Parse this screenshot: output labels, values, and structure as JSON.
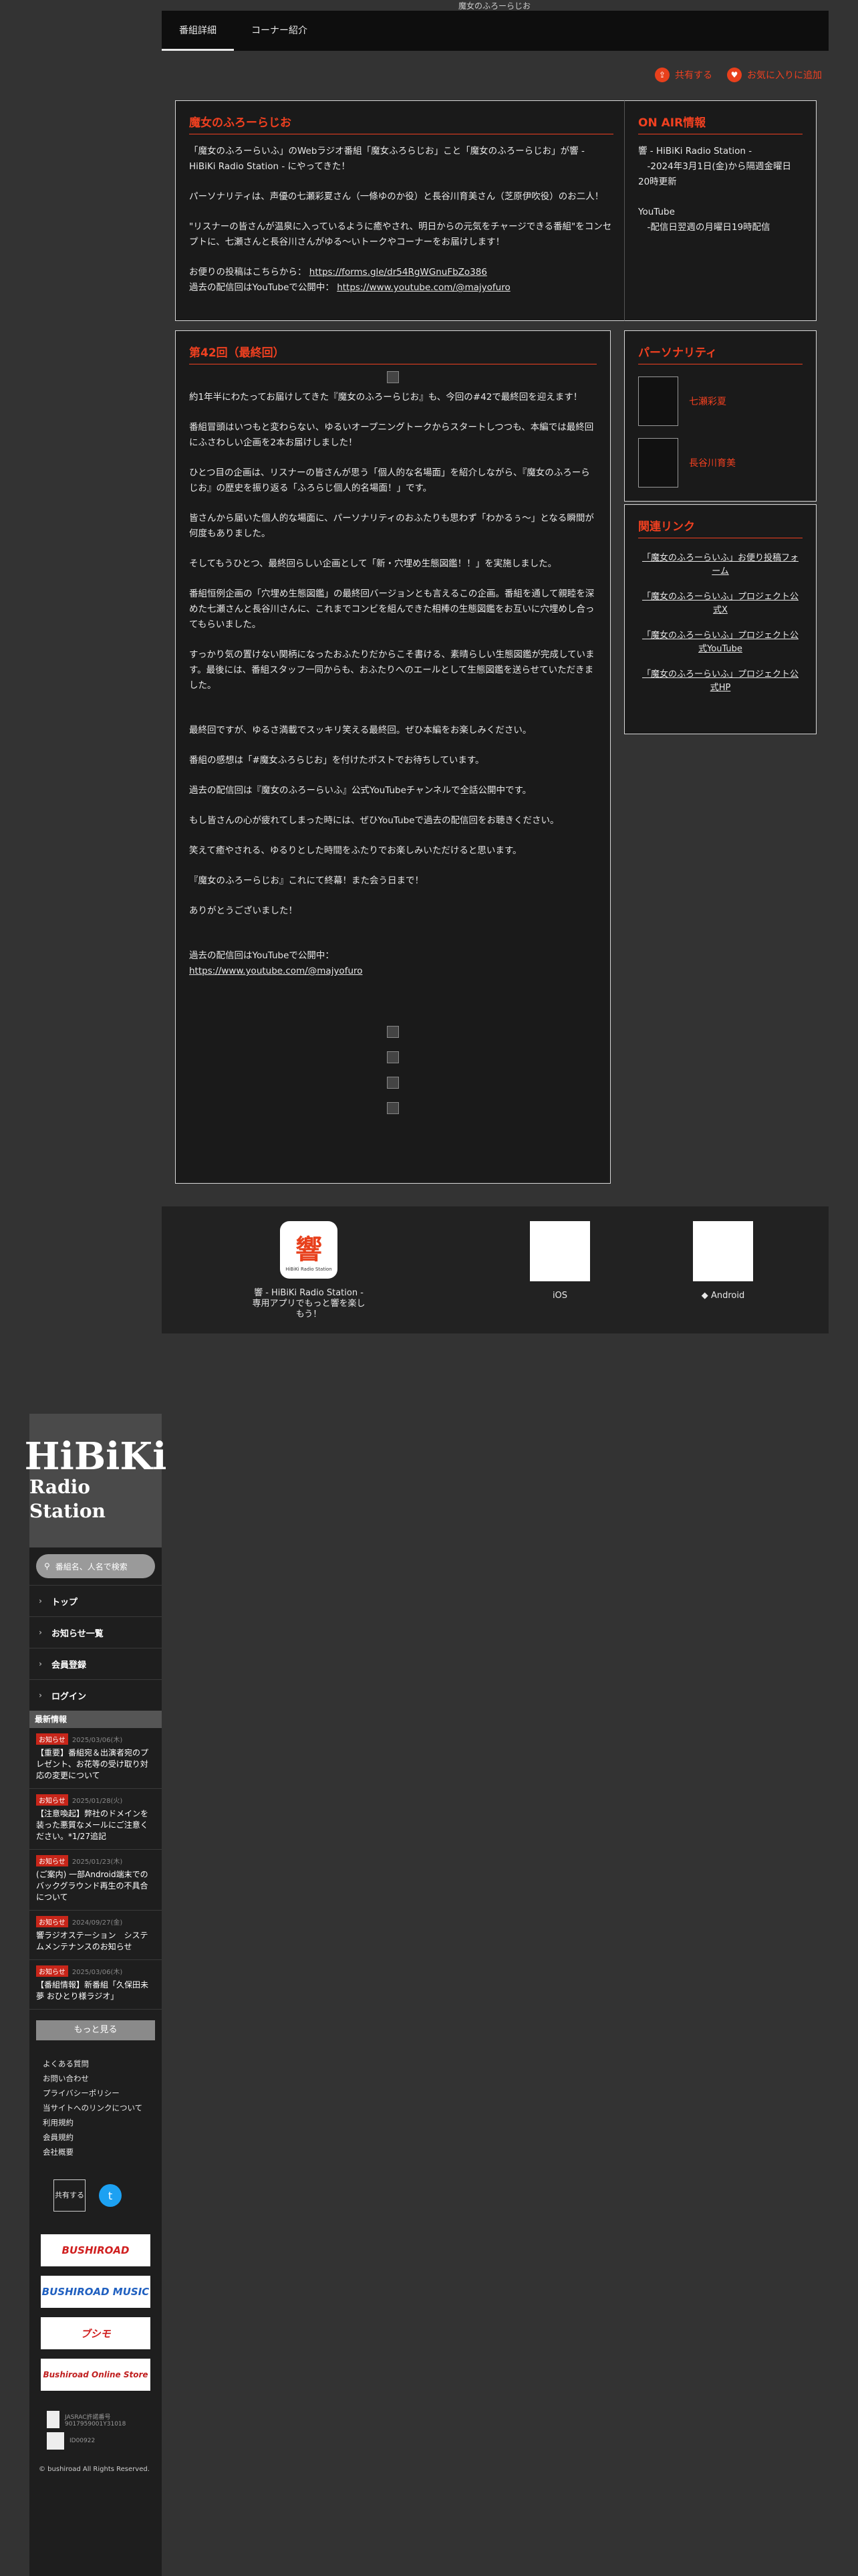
{
  "header": {
    "image_alt": "魔女のふろーらじお"
  },
  "tabs": [
    {
      "label": "番組詳細"
    },
    {
      "label": "コーナー紹介"
    }
  ],
  "actions": {
    "share": "共有する",
    "favorite": "お気に入りに追加"
  },
  "intro": {
    "title": "魔女のふろーらじお",
    "p1": "「魔女のふろーらいふ」のWebラジオ番組「魔女ふろらじお」こと「魔女のふろーらじお」が響 - HiBiKi Radio Station - にやってきた！",
    "p2": "パーソナリティは、声優の七瀬彩夏さん（一條ゆのか役）と長谷川育美さん（芝原伊吹役）のお二人！",
    "p3": "\"リスナーの皆さんが温泉に入っているように癒やされ、明日からの元気をチャージできる番組\"をコンセプトに、七瀬さんと長谷川さんがゆる〜いトークやコーナーをお届けします！",
    "post_label": "お便りの投稿はこちらから：",
    "post_url": "https://forms.gle/dr54RgWGnuFbZo386",
    "youtube_label": "過去の配信回はYouTubeで公開中：",
    "youtube_url": "https://www.youtube.com/@majyofuro"
  },
  "onair": {
    "title": "ON AIR情報",
    "l1": "響 - HiBiKi Radio Station -",
    "l2": "　-2024年3月1日(金)から隔週金曜日20時更新",
    "l3": "YouTube",
    "l4": "　-配信日翌週の月曜日19時配信"
  },
  "episode": {
    "title": "第42回（最終回）",
    "p1": "約1年半にわたってお届けしてきた『魔女のふろーらじお』も、今回の#42で最終回を迎えます！",
    "p2": "番組冒頭はいつもと変わらない、ゆるいオープニングトークからスタートしつつも、本編では最終回にふさわしい企画を2本お届けしました！",
    "p3": "ひとつ目の企画は、リスナーの皆さんが思う「個人的な名場面」を紹介しながら、『魔女のふろーらじお』の歴史を振り返る「ふろらじ個人的名場面！」です。",
    "p4": "皆さんから届いた個人的な場面に、パーソナリティのおふたりも思わず「わかるぅ〜」となる瞬間が何度もありました。",
    "p5": "そしてもうひとつ、最終回らしい企画として「新・穴埋め生態図鑑！！」を実施しました。",
    "p6": "番組恒例企画の「穴埋め生態図鑑」の最終回バージョンとも言えるこの企画。番組を通して親睦を深めた七瀬さんと長谷川さんに、これまでコンビを組んできた相棒の生態図鑑をお互いに穴埋めし合ってもらいました。",
    "p7": "すっかり気の置けない関柄になったおふたりだからこそ書ける、素晴らしい生態図鑑が完成しています。最後には、番組スタッフ一同からも、おふたりへのエールとして生態図鑑を送らせていただきました。",
    "p8": "最終回ですが、ゆるさ満載でスッキリ笑える最終回。ぜひ本編をお楽しみください。",
    "p9": "番組の感想は「#魔女ふろらじお」を付けたポストでお待ちしています。",
    "p10": "過去の配信回は『魔女のふろーらいふ』公式YouTubeチャンネルで全話公開中です。",
    "p11": "もし皆さんの心が疲れてしまった時には、ぜひYouTubeで過去の配信回をお聴きください。",
    "p12": "笑えて癒やされる、ゆるりとした時間をふたりでお楽しみいただけると思います。",
    "p13": "『魔女のふろーらじお』これにて終幕！また会う日まで！",
    "p14": "ありがとうございました！",
    "yt_label": "過去の配信回はYouTubeで公開中：",
    "yt_url": "https://www.youtube.com/@majyofuro"
  },
  "personality": {
    "title": "パーソナリティ",
    "p1": "七瀬彩夏",
    "p2": "長谷川育美"
  },
  "related": {
    "title": "関連リンク",
    "links": [
      "「魔女のふろーらいふ」お便り投稿フォーム",
      "「魔女のふろーらいふ」プロジェクト公式X",
      "「魔女のふろーらいふ」プロジェクト公式YouTube",
      "「魔女のふろーらいふ」プロジェクト公式HP"
    ]
  },
  "app": {
    "text": "響 - HiBiKi Radio Station - 専用アプリでもっと響を楽しもう！",
    "ios": "iOS",
    "android": "Android",
    "logo_sub": "HiBiKi Radio Station"
  },
  "sidebar": {
    "logo1": "HiBiKi",
    "logo2": "Radio Station",
    "search_placeholder": "番組名、人名で検索",
    "nav": [
      "トップ",
      "お知らせ一覧",
      "会員登録",
      "ログイン"
    ],
    "news_head": "最新情報",
    "news": [
      {
        "badge": "お知らせ",
        "date": "2025/03/06(木)",
        "text": "【重要】番組宛＆出演者宛のプレゼント、お花等の受け取り対応の変更について"
      },
      {
        "badge": "お知らせ",
        "date": "2025/01/28(火)",
        "text": "【注意喚起】弊社のドメインを装った悪質なメールにご注意ください。*1/27追記"
      },
      {
        "badge": "お知らせ",
        "date": "2025/01/23(木)",
        "text": "(ご案内) 一部Android端末でのバックグラウンド再生の不具合について"
      },
      {
        "badge": "お知らせ",
        "date": "2024/09/27(金)",
        "text": "響ラジオステーション　システムメンテナンスのお知らせ"
      },
      {
        "badge": "お知らせ",
        "date": "2025/03/06(木)",
        "text": "【番組情報】新番組「久保田未夢 おひとり様ラジオ」"
      }
    ],
    "more": "もっと見る",
    "footer_links": [
      "よくある質問",
      "お問い合わせ",
      "プライバシーポリシー",
      "当サイトへのリンクについて",
      "利用規約",
      "会員規約",
      "会社概要"
    ],
    "share": "共有する",
    "brands": [
      "BUSHIROAD",
      "BUSHIROAD MUSIC",
      "ブシモ",
      "Bushiroad Online Store"
    ],
    "jasrac1": "JASRAC許諾番号 9017959001Y31018",
    "jasrac2": "ID00922",
    "copyright": "© bushiroad All Rights Reserved."
  },
  "colors": {
    "accent": "#f04020",
    "background": "#333333",
    "panel": "#1a1a1a"
  }
}
